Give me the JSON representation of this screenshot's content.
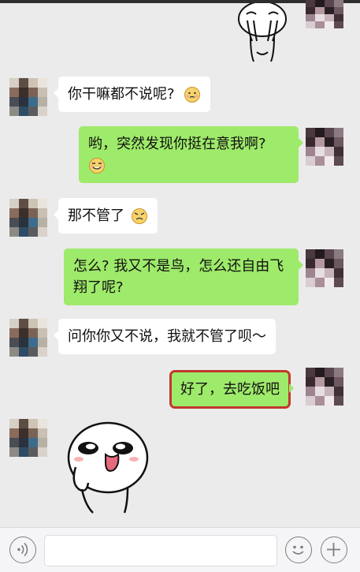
{
  "chat": {
    "messages": [
      {
        "side": "in",
        "text": "你干嘛都不说呢?",
        "emoji": "embarrassed-face"
      },
      {
        "side": "out",
        "text": "哟，突然发现你挺在意我啊?",
        "emoji": "smug-face"
      },
      {
        "side": "in",
        "text": "那不管了",
        "emoji": "annoyed-face"
      },
      {
        "side": "out",
        "text": "怎么? 我又不是鸟，怎么还自由飞翔了呢?"
      },
      {
        "side": "in",
        "text": "问你你又不说，我就不管了呗～"
      },
      {
        "side": "out",
        "text": "好了，去吃饭吧",
        "highlighted": true
      }
    ],
    "stickers": [
      {
        "side": "out",
        "name": "crying-cartoon-sticker"
      },
      {
        "side": "in",
        "name": "tongue-out-cartoon-sticker"
      }
    ]
  },
  "input_bar": {
    "voice_icon": "voice-icon",
    "text_value": "",
    "emoji_icon": "emoji-icon",
    "plus_icon": "plus-icon"
  },
  "colors": {
    "background": "#ebebeb",
    "incoming_bubble": "#ffffff",
    "outgoing_bubble": "#9eea6a",
    "highlight_border": "#c0392b"
  }
}
